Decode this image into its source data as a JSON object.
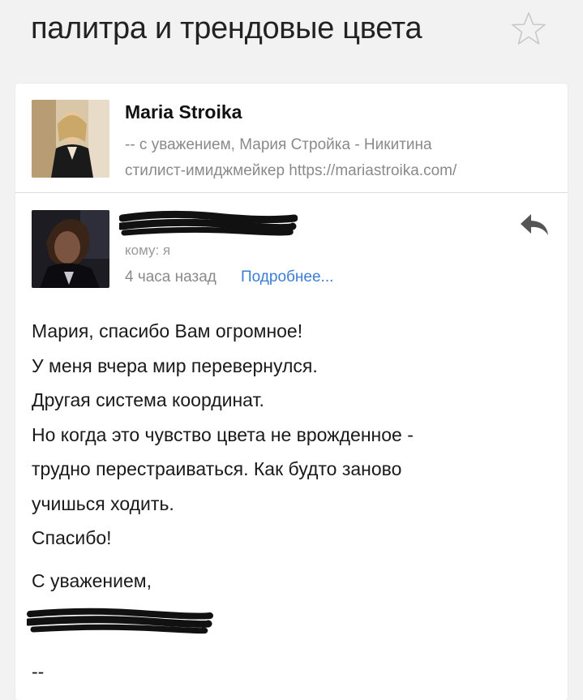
{
  "header": {
    "subject": "палитра и трендовые цвета",
    "star_icon": "star-outline-icon"
  },
  "thread": {
    "first_message": {
      "sender": "Maria Stroika",
      "snippet_line1": "-- с уважением, Мария Стройка - Никитина",
      "snippet_line2": "стилист-имиджмейкер https://mariastroika.com/"
    },
    "second_message": {
      "sender": "",
      "to_line": "кому: я",
      "time": "4 часа назад",
      "details_link": "Подробнее...",
      "reply_icon": "reply-icon",
      "body_lines": [
        "Мария, спасибо Вам огромное!",
        "У меня вчера мир перевернулся.",
        "Другая система координат.",
        "Но когда это чувство цвета не врожденное -",
        "трудно перестраиваться. Как будто заново",
        "учишься ходить.",
        "Спасибо!"
      ],
      "signoff": "С уважением,",
      "signature_name": "",
      "signature_separator": "--"
    }
  },
  "colors": {
    "link": "#3b7dd8",
    "muted_text": "#8a8a8a",
    "background": "#f2f2f2"
  }
}
